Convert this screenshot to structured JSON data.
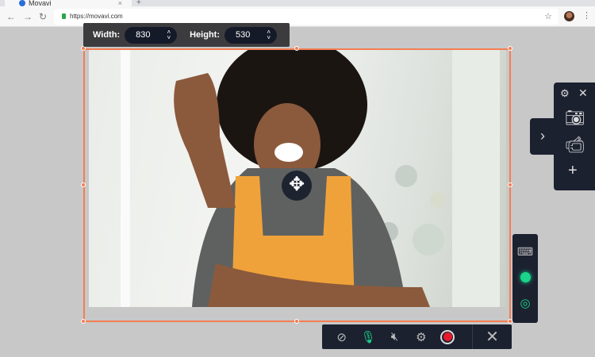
{
  "browser": {
    "tab_title": "Movavi",
    "url": "https://movavi.com"
  },
  "size_toolbar": {
    "width_label": "Width:",
    "width_value": "830",
    "height_label": "Height:",
    "height_value": "530"
  },
  "bottom_toolbar": {
    "items": [
      "webcam-off",
      "microphone",
      "system-audio-off",
      "settings",
      "record",
      "close"
    ]
  },
  "side_panel": {
    "items": [
      "settings",
      "close",
      "screenshot",
      "record-video",
      "add"
    ]
  },
  "effects_panel": {
    "items": [
      "keystrokes",
      "mouse-highlight",
      "click-effect"
    ]
  },
  "colors": {
    "accent": "#f47d52",
    "panel": "#1c2130",
    "green": "#19d48a",
    "record": "#e8192c"
  }
}
